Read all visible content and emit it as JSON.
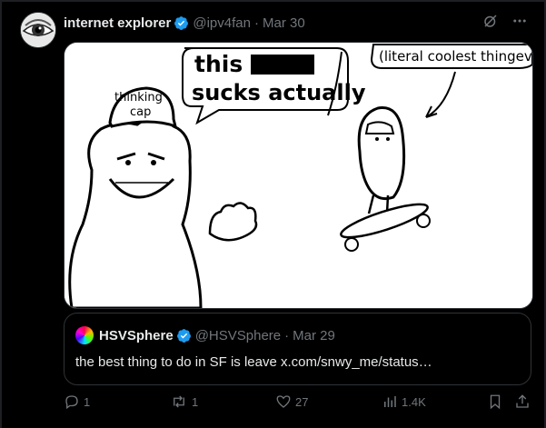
{
  "post": {
    "author_name": "internet explorer",
    "author_handle": "@ipv4fan",
    "separator": "·",
    "date": "Mar 30"
  },
  "meme": {
    "bubble_left_line1": "this f",
    "bubble_left_line2": "sucks actually",
    "bubble_right": "(literal coolest thingever)",
    "cap_text_line1": "thinking",
    "cap_text_line2": "cap"
  },
  "quote": {
    "author_name": "HSVSphere",
    "author_handle": "@HSVSphere",
    "separator": "·",
    "date": "Mar 29",
    "text": "the best thing to do in SF is leave x.com/snwy_me/status…"
  },
  "actions": {
    "replies": "1",
    "reposts": "1",
    "likes": "27",
    "views": "1.4K"
  },
  "colors": {
    "background": "#000000",
    "text": "#e7e9ea",
    "muted": "#71767b",
    "verified": "#1d9bf0",
    "border": "#2f3336"
  }
}
